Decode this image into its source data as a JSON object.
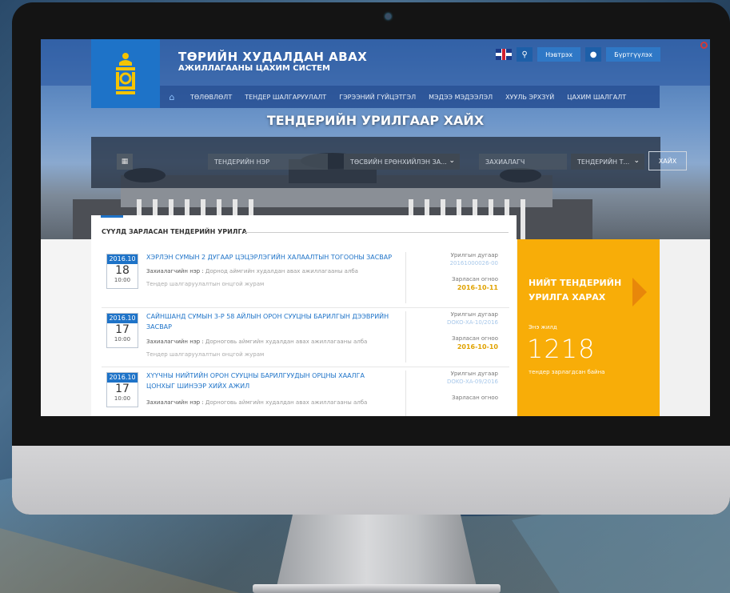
{
  "site": {
    "title_line1": "ТӨРИЙН ХУДАЛДАН АВАХ",
    "title_line2": "АЖИЛЛАГААНЫ ЦАХИМ СИСТЕМ",
    "login_label": "Нэвтрэх",
    "register_label": "Бүртгүүлэх"
  },
  "nav": {
    "items": [
      "ТӨЛӨВЛӨЛТ",
      "ТЕНДЕР ШАЛГАРУУЛАЛТ",
      "ГЭРЭЭНИЙ ГҮЙЦЭТГЭЛ",
      "МЭДЭЭ МЭДЭЭЛЭЛ",
      "ХУУЛЬ ЭРХЗҮЙ",
      "ЦАХИМ ШАЛГАЛТ"
    ]
  },
  "hero": {
    "title": "ТЕНДЕРИЙН УРИЛГААР ХАЙХ"
  },
  "search": {
    "name_placeholder": "ТЕНДЕРИЙН НЭР",
    "budget_select": "ТӨСВИЙН ЕРӨНХИЙЛЭН ЗА...",
    "customer_placeholder": "ЗАХИАЛАГЧ",
    "type_select": "ТЕНДЕРИЙН Т...",
    "search_button": "ХАЙХ"
  },
  "section": {
    "title": "СҮҮЛД ЗАРЛАСАН ТЕНДЕРИЙН УРИЛГА"
  },
  "tenders": [
    {
      "ym": "2016.10",
      "day": "18",
      "time": "10:00",
      "title": "ХЭРЛЭН СУМЫН 2 ДУГААР ЦЭЦЭРЛЭГИЙН ХАЛААЛТЫН ТОГООНЫ ЗАСВАР",
      "customer_label": "Захиалагчийн нэр :",
      "customer": "Дорнод аймгийн худалдан авах ажиллагааны алба",
      "method": "Тендер шалгаруулалтын онцгой журам",
      "invite_label": "Урилгын дугаар",
      "invite_no": "20161000026-00",
      "date_label": "Зарласан огноо",
      "date": "2016-10-11"
    },
    {
      "ym": "2016.10",
      "day": "17",
      "time": "10:00",
      "title": "САЙНШАНД СУМЫН 3-Р 58 АЙЛЫН ОРОН СУУЦНЫ БАРИЛГЫН ДЭЭВРИЙН ЗАСВАР",
      "customer_label": "Захиалагчийн нэр :",
      "customer": "Дорноговь аймгийн худалдан авах ажиллагааны алба",
      "method": "Тендер шалгаруулалтын онцгой журам",
      "invite_label": "Урилгын дугаар",
      "invite_no": "DOKO-XA-10/2016",
      "date_label": "Зарласан огноо",
      "date": "2016-10-10"
    },
    {
      "ym": "2016.10",
      "day": "17",
      "time": "10:00",
      "title": "ХҮҮЧНЫ НИЙТИЙН ОРОН СУУЦНЫ БАРИЛГУУДЫН ОРЦНЫ ХААЛГА ЦОНХЫГ ШИНЭЭР ХИЙХ АЖИЛ",
      "customer_label": "Захиалагчийн нэр :",
      "customer": "Дорноговь аймгийн худалдан авах ажиллагааны алба",
      "method": "",
      "invite_label": "Урилгын дугаар",
      "invite_no": "DOKO-XA-09/2016",
      "date_label": "Зарласан огноо",
      "date": ""
    }
  ],
  "summary": {
    "title_line1": "НИЙТ ТЕНДЕРИЙН",
    "title_line2": "УРИЛГА ХАРАХ",
    "year_label": "Энэ жилд",
    "count": "1218",
    "note": "тендер зарлагдсан байна"
  },
  "colors": {
    "accent": "#1e73c8",
    "orange": "#f8ad08",
    "date_gold": "#e0a200"
  },
  "icons": [
    "emblem-icon",
    "search-icon",
    "user-icon",
    "home-icon",
    "calendar-icon",
    "chevron-down-icon",
    "arrow-right-icon",
    "uk-flag-icon"
  ]
}
